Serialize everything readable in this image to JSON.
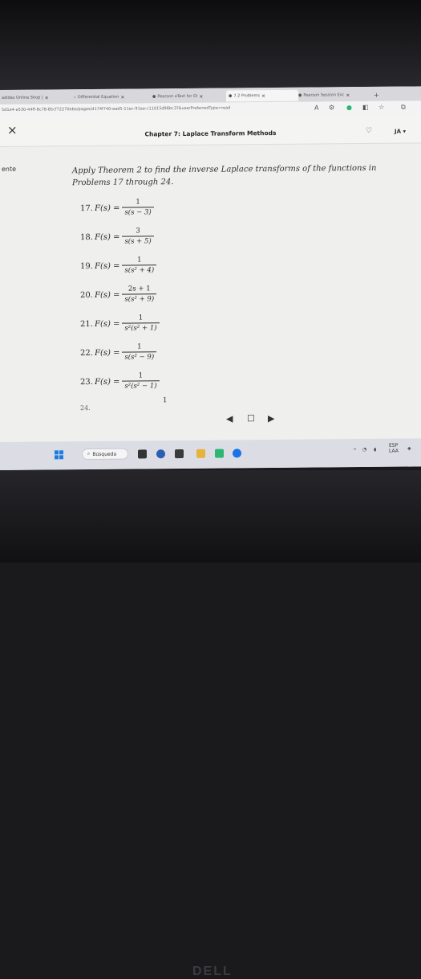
{
  "browser": {
    "tabs": [
      {
        "label": "adidas Online Shop |"
      },
      {
        "label": "Differential Equation"
      },
      {
        "label": "Pearson eText for Di"
      },
      {
        "label": "7.2 Problems"
      },
      {
        "label": "Pearson Session Exc"
      }
    ],
    "url": "5d1e4-e530-44ff-8c78-85cf72270ebe/pages/d174f740-ead5-11ec-91ae-c11015d96bc3?&userPreferredType=read"
  },
  "header": {
    "title": "Chapter 7: Laplace Transform Methods",
    "user_initials": "JA"
  },
  "sidebar": {
    "label": "ente"
  },
  "content": {
    "intro": "Apply Theorem 2 to find the inverse Laplace transforms of the functions in Problems 17 through 24.",
    "problems": [
      {
        "num": "17.",
        "lhs": "F(s) =",
        "numerator": "1",
        "denominator": "s(s − 3)"
      },
      {
        "num": "18.",
        "lhs": "F(s) =",
        "numerator": "3",
        "denominator": "s(s + 5)"
      },
      {
        "num": "19.",
        "lhs": "F(s) =",
        "numerator": "1",
        "denominator": "s(s² + 4)"
      },
      {
        "num": "20.",
        "lhs": "F(s) =",
        "numerator": "2s + 1",
        "denominator": "s(s² + 9)"
      },
      {
        "num": "21.",
        "lhs": "F(s) =",
        "numerator": "1",
        "denominator": "s²(s² + 1)"
      },
      {
        "num": "22.",
        "lhs": "F(s) =",
        "numerator": "1",
        "denominator": "s(s² − 9)"
      },
      {
        "num": "23.",
        "lhs": "F(s) =",
        "numerator": "1",
        "denominator": "s²(s² − 1)"
      }
    ],
    "partial_cutoff": "24.",
    "partial_numerator": "1"
  },
  "pager": {
    "prev": "◀",
    "bookmark": "☐",
    "next": "▶"
  },
  "taskbar": {
    "search_label": "Búsqueda",
    "lang": "ESP",
    "region": "LAA"
  },
  "bezel": {
    "brand": "DELL"
  },
  "colors": {
    "windows_blue": "#1d7be0",
    "accent_green": "#2bb673",
    "edge_blue": "#1a73e8"
  }
}
